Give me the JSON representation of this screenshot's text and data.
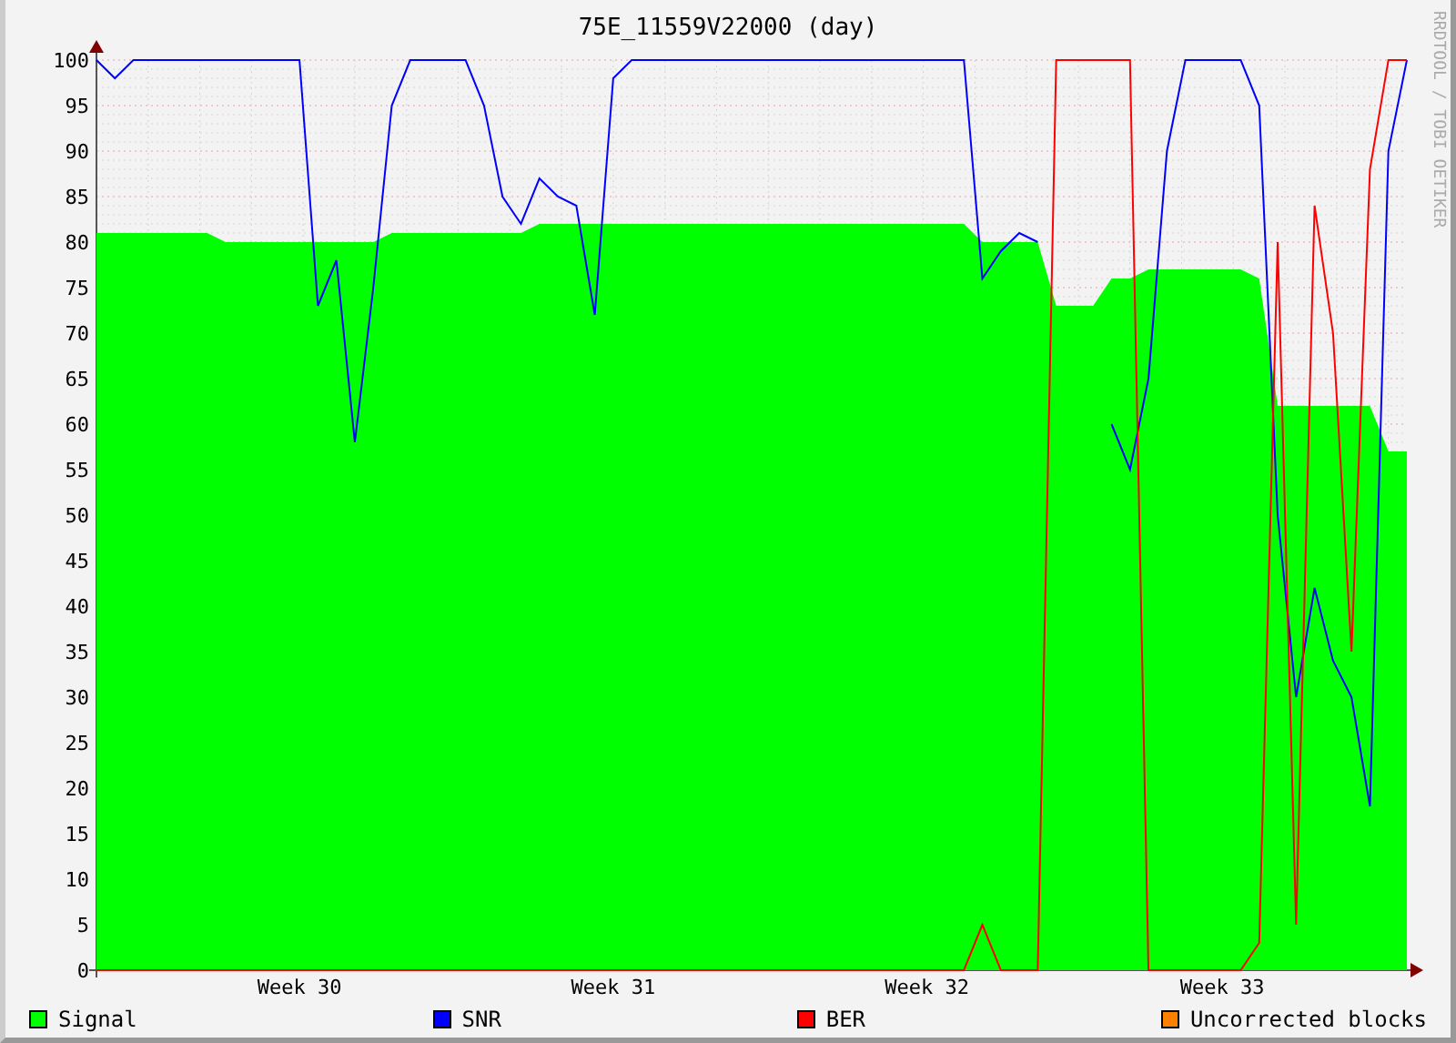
{
  "title": "75E_11559V22000 (day)",
  "credit": "RRDTOOL / TOBI OETIKER",
  "chart_data": {
    "type": "area",
    "grid": true,
    "ylim": [
      0,
      100
    ],
    "yticks": [
      0,
      5,
      10,
      15,
      20,
      25,
      30,
      35,
      40,
      45,
      50,
      55,
      60,
      65,
      70,
      75,
      80,
      85,
      90,
      95,
      100
    ],
    "categories": [
      null,
      null,
      null,
      null,
      null,
      null,
      null,
      null,
      null,
      null,
      null,
      "Week 30",
      null,
      null,
      null,
      null,
      null,
      null,
      null,
      null,
      null,
      null,
      null,
      null,
      null,
      null,
      null,
      null,
      "Week 31",
      null,
      null,
      null,
      null,
      null,
      null,
      null,
      null,
      null,
      null,
      null,
      null,
      null,
      null,
      null,
      null,
      "Week 32",
      null,
      null,
      null,
      null,
      null,
      null,
      null,
      null,
      null,
      null,
      null,
      null,
      null,
      null,
      null,
      "Week 33",
      null,
      null,
      null,
      null,
      null,
      null,
      null,
      null,
      null,
      null
    ],
    "series": [
      {
        "name": "Signal",
        "color": "#00ff00",
        "values": [
          81,
          81,
          81,
          81,
          81,
          81,
          81,
          80,
          80,
          80,
          80,
          80,
          80,
          80,
          80,
          80,
          81,
          81,
          81,
          81,
          81,
          81,
          81,
          81,
          82,
          82,
          82,
          82,
          82,
          82,
          82,
          82,
          82,
          82,
          82,
          82,
          82,
          82,
          82,
          82,
          82,
          82,
          82,
          82,
          82,
          82,
          82,
          82,
          80,
          80,
          80,
          80,
          73,
          73,
          73,
          76,
          76,
          77,
          77,
          77,
          77,
          77,
          77,
          76,
          62,
          62,
          62,
          62,
          62,
          62,
          57,
          57
        ]
      },
      {
        "name": "SNR",
        "color": "#0000ff",
        "type": "line",
        "values": [
          100,
          98,
          100,
          100,
          100,
          100,
          100,
          100,
          100,
          100,
          100,
          100,
          73,
          78,
          58,
          75,
          95,
          100,
          100,
          100,
          100,
          95,
          85,
          82,
          87,
          85,
          84,
          72,
          98,
          100,
          100,
          100,
          100,
          100,
          100,
          100,
          100,
          100,
          100,
          100,
          100,
          100,
          100,
          100,
          100,
          100,
          100,
          100,
          76,
          79,
          81,
          80,
          null,
          null,
          null,
          60,
          55,
          65,
          90,
          100,
          100,
          100,
          100,
          95,
          50,
          30,
          42,
          34,
          30,
          18,
          90,
          100
        ]
      },
      {
        "name": "BER",
        "color": "#ff0000",
        "type": "line",
        "values": [
          0,
          0,
          0,
          0,
          0,
          0,
          0,
          0,
          0,
          0,
          0,
          0,
          0,
          0,
          0,
          0,
          0,
          0,
          0,
          0,
          0,
          0,
          0,
          0,
          0,
          0,
          0,
          0,
          0,
          0,
          0,
          0,
          0,
          0,
          0,
          0,
          0,
          0,
          0,
          0,
          0,
          0,
          0,
          0,
          0,
          0,
          0,
          0,
          5,
          0,
          0,
          0,
          100,
          100,
          100,
          100,
          100,
          0,
          0,
          0,
          0,
          0,
          0,
          3,
          80,
          5,
          84,
          70,
          35,
          88,
          100,
          100
        ]
      },
      {
        "name": "Uncorrected blocks",
        "color": "#ff8000",
        "type": "line",
        "values": [
          null,
          null,
          null,
          null,
          null,
          null,
          null,
          null,
          null,
          null,
          null,
          null,
          null,
          null,
          null,
          null,
          null,
          null,
          null,
          null,
          null,
          null,
          null,
          null,
          null,
          null,
          null,
          null,
          null,
          null,
          null,
          null,
          null,
          null,
          null,
          null,
          null,
          null,
          null,
          null,
          null,
          null,
          null,
          null,
          null,
          null,
          null,
          null,
          null,
          null,
          null,
          null,
          null,
          null,
          null,
          null,
          null,
          null,
          null,
          null,
          null,
          null,
          null,
          null,
          null,
          null,
          null,
          null,
          null,
          null,
          null,
          null
        ]
      }
    ]
  }
}
